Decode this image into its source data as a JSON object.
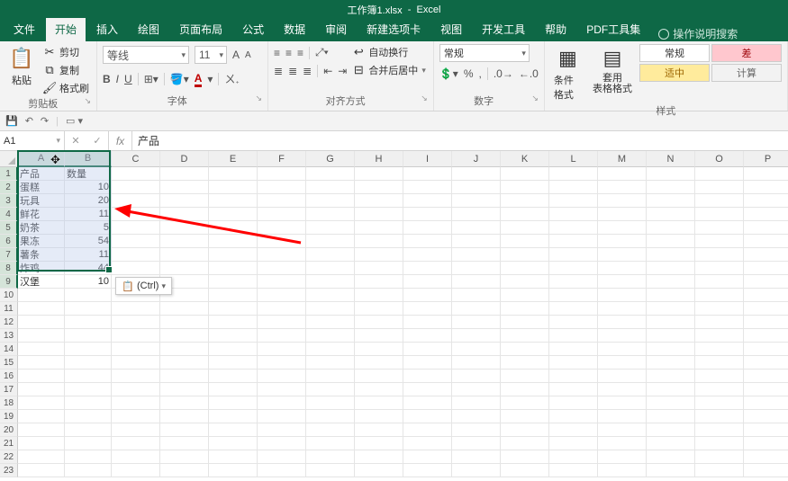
{
  "title": {
    "workbook": "工作簿1.xlsx",
    "app": "Excel",
    "sep": "  -  "
  },
  "tabs": [
    "文件",
    "开始",
    "插入",
    "绘图",
    "页面布局",
    "公式",
    "数据",
    "审阅",
    "新建选项卡",
    "视图",
    "开发工具",
    "帮助",
    "PDF工具集"
  ],
  "search_placeholder": "操作说明搜索",
  "clipboard": {
    "paste": "粘贴",
    "cut": "剪切",
    "copy": "复制",
    "format_painter": "格式刷",
    "group": "剪贴板"
  },
  "font": {
    "name": "等线",
    "size": "11",
    "b": "B",
    "i": "I",
    "u": "U",
    "group": "字体"
  },
  "align": {
    "wrap": "自动换行",
    "merge": "合并后居中",
    "group": "对齐方式"
  },
  "number": {
    "format": "常规",
    "group": "数字"
  },
  "styles_group": {
    "cond": "条件格式",
    "table": "套用\n表格格式",
    "s_normal": "常规",
    "s_bad": "差",
    "s_neutral": "适中",
    "s_calc": "计算",
    "group": "样式"
  },
  "namebox": "A1",
  "formula": "产品",
  "columns": [
    "A",
    "B",
    "C",
    "D",
    "E",
    "F",
    "G",
    "H",
    "I",
    "J",
    "K",
    "L",
    "M",
    "N",
    "O",
    "P"
  ],
  "data_rows": [
    {
      "a": "产品",
      "b": "数量"
    },
    {
      "a": "蛋糕",
      "b": "10"
    },
    {
      "a": "玩具",
      "b": "20"
    },
    {
      "a": "鲜花",
      "b": "11"
    },
    {
      "a": "奶茶",
      "b": "5"
    },
    {
      "a": "果冻",
      "b": "54"
    },
    {
      "a": "薯条",
      "b": "11"
    },
    {
      "a": "炸鸡",
      "b": "44"
    },
    {
      "a": "汉堡",
      "b": "10"
    }
  ],
  "total_rows": 23,
  "paste_options": "(Ctrl)"
}
